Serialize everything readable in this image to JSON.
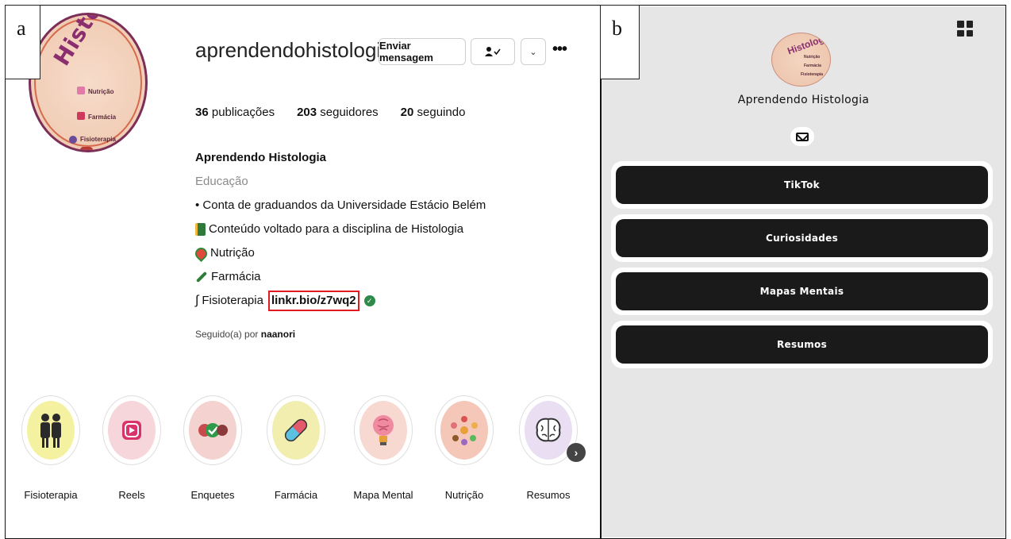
{
  "panel_labels": {
    "a": "a",
    "b": "b"
  },
  "profile": {
    "avatar": {
      "title": "Histologia",
      "items": [
        "Nutrição",
        "Farmácia",
        "Fisioterapia"
      ]
    },
    "username": "aprendendohistologia_",
    "buttons": {
      "message": "Enviar mensagem",
      "following_icon": "person-check-icon",
      "dropdown_icon": "chevron-down-icon",
      "more_icon": "more-dots-icon"
    },
    "stats": [
      {
        "count": "36",
        "label": "publicações"
      },
      {
        "count": "203",
        "label": "seguidores"
      },
      {
        "count": "20",
        "label": "seguindo"
      }
    ],
    "bio": {
      "name": "Aprendendo Histologia",
      "category": "Educação",
      "line1": "• Conta de graduandos da Universidade Estácio Belém",
      "line2": "Conteúdo voltado para a disciplina de Histologia",
      "line3": "Nutrição",
      "line4": "Farmácia",
      "line5": "Fisioterapia",
      "link": "linkr.bio/z7wq2"
    },
    "followed_by_prefix": "Seguido(a) por",
    "followed_by_user": "naanori",
    "highlights": [
      {
        "label": "Fisioterapia",
        "icon": "elderly-couple-icon",
        "color": "#f4f2a0"
      },
      {
        "label": "Reels",
        "icon": "reels-icon",
        "color": "#f6d6da"
      },
      {
        "label": "Enquetes",
        "icon": "poll-check-icon",
        "color": "#f3d2cf"
      },
      {
        "label": "Farmácia",
        "icon": "pill-icon",
        "color": "#f1eeb0"
      },
      {
        "label": "Mapa Mental",
        "icon": "brain-bulb-icon",
        "color": "#f7d9d2"
      },
      {
        "label": "Nutrição",
        "icon": "food-plate-icon",
        "color": "#f4c7b9"
      },
      {
        "label": "Resumos",
        "icon": "brain-icon",
        "color": "#e9def2"
      }
    ]
  },
  "linktree": {
    "avatar_title": "Histologia",
    "avatar_items": [
      "Nutrição",
      "Farmácia",
      "Fisioterapia"
    ],
    "name": "Aprendendo Histologia",
    "links": [
      "TikTok",
      "Curiosidades",
      "Mapas Mentais",
      "Resumos"
    ]
  }
}
